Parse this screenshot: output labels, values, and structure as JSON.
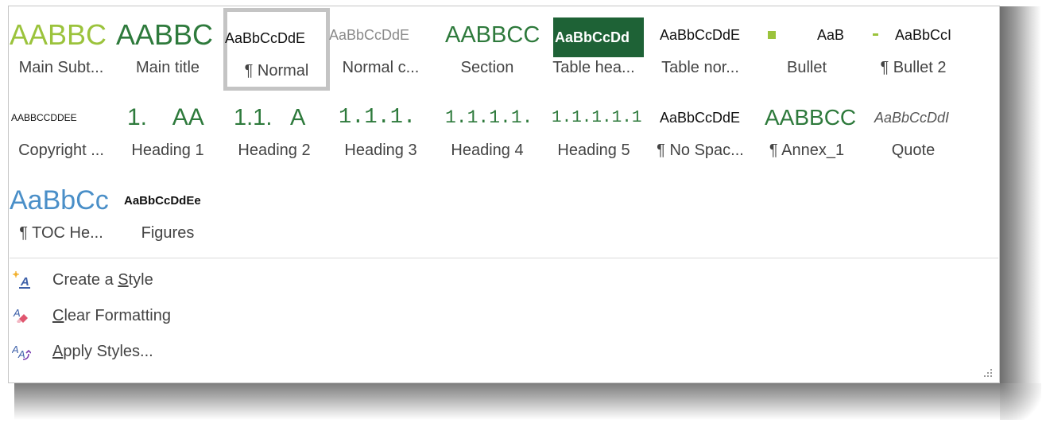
{
  "styles": [
    {
      "preview": "AABBC",
      "label": "Main Subt..."
    },
    {
      "preview": "AABBC",
      "label": "Main title"
    },
    {
      "preview": "AaBbCcDdE",
      "label": "¶ Normal"
    },
    {
      "preview": "AaBbCcDdE",
      "label": "Normal c..."
    },
    {
      "preview": "AABBCC",
      "label": "Section"
    },
    {
      "preview": "AaBbCcDd",
      "label": "Table hea..."
    },
    {
      "preview": "AaBbCcDdE",
      "label": "Table nor..."
    },
    {
      "preview": "AaB",
      "label": "Bullet"
    },
    {
      "preview": "AaBbCcI",
      "label": "¶ Bullet 2"
    },
    {
      "preview": "AABBCCDDEE",
      "label": "Copyright ..."
    },
    {
      "preview": "1.    AA",
      "label": "Heading 1"
    },
    {
      "preview": "1.1.   A",
      "label": "Heading 2"
    },
    {
      "preview": "1.1.1.   .",
      "label": "Heading 3"
    },
    {
      "preview": "1.1.1.1.",
      "label": "Heading 4"
    },
    {
      "preview": "1.1.1.1.1",
      "label": "Heading 5"
    },
    {
      "preview": "AaBbCcDdE",
      "label": "¶ No Spac..."
    },
    {
      "preview": "AABBCC",
      "label": "¶ Annex_1"
    },
    {
      "preview": "AaBbCcDdI",
      "label": "Quote"
    },
    {
      "preview": "AaBbCc",
      "label": "¶ TOC He..."
    },
    {
      "preview": "AaBbCcDdEe",
      "label": "Figures"
    }
  ],
  "commands": {
    "create_style": {
      "pre": "Create a ",
      "key": "S",
      "post": "tyle"
    },
    "clear_formatting": {
      "pre": "",
      "key": "C",
      "post": "lear Formatting"
    },
    "apply_styles": {
      "pre": "",
      "key": "A",
      "post": "pply Styles..."
    }
  },
  "colors": {
    "accent_green": "#9bc33c",
    "dark_green": "#2e7a3c",
    "table_header_bg": "#1e6236",
    "toc_blue": "#4a8fc8",
    "selected_border": "#c4c4c4"
  }
}
